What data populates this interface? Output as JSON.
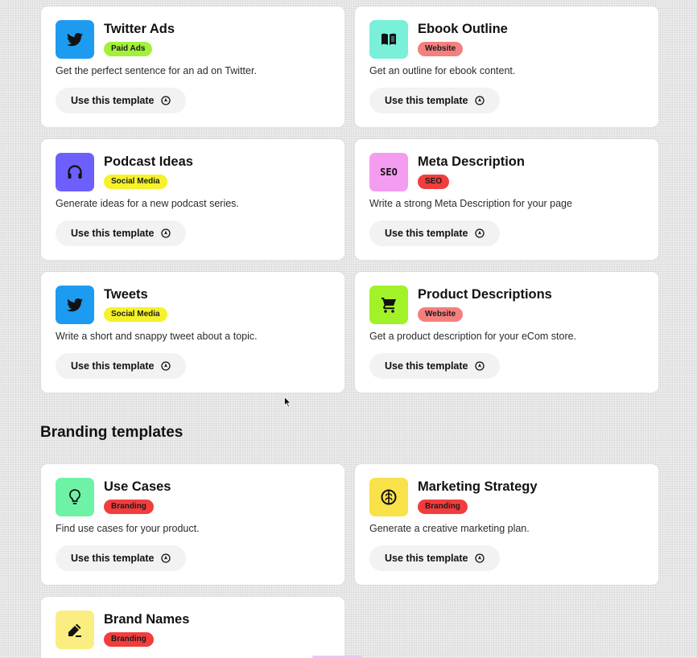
{
  "button_label": "Use this template",
  "colors": {
    "blue": "#1d9bf0",
    "mint": "#7af0d9",
    "purple": "#6d5ffb",
    "pink": "#f49cf0",
    "lime": "#a2f229",
    "seafoam": "#6ef2a6",
    "yellow": "#f9e14a",
    "light_yellow": "#faee82",
    "badge_green": "#a3f03b",
    "badge_salmon": "#f47f7f",
    "badge_yellow": "#f5f22a",
    "badge_red": "#f23d3d"
  },
  "templates": [
    {
      "title": "Twitter Ads",
      "badge": "Paid Ads",
      "description": "Get the perfect sentence for an ad on Twitter.",
      "icon": "twitter-icon"
    },
    {
      "title": "Ebook Outline",
      "badge": "Website",
      "description": "Get an outline for ebook content.",
      "icon": "book-icon"
    },
    {
      "title": "Podcast Ideas",
      "badge": "Social Media",
      "description": "Generate ideas for a new podcast series.",
      "icon": "headphones-icon"
    },
    {
      "title": "Meta Description",
      "badge": "SEO",
      "description": "Write a strong Meta Description for your page",
      "icon": "seo-icon",
      "icon_text": "SEO"
    },
    {
      "title": "Tweets",
      "badge": "Social Media",
      "description": "Write a short and snappy tweet about a topic.",
      "icon": "twitter-icon"
    },
    {
      "title": "Product Descriptions",
      "badge": "Website",
      "description": "Get a product description for your eCom store.",
      "icon": "shopping-cart-icon"
    }
  ],
  "branding_heading": "Branding templates",
  "branding_templates": [
    {
      "title": "Use Cases",
      "badge": "Branding",
      "description": "Find use cases for your product.",
      "icon": "lightbulb-icon"
    },
    {
      "title": "Marketing Strategy",
      "badge": "Branding",
      "description": "Generate a creative marketing plan.",
      "icon": "brain-icon"
    },
    {
      "title": "Brand Names",
      "badge": "Branding",
      "icon": "pen-icon"
    }
  ]
}
